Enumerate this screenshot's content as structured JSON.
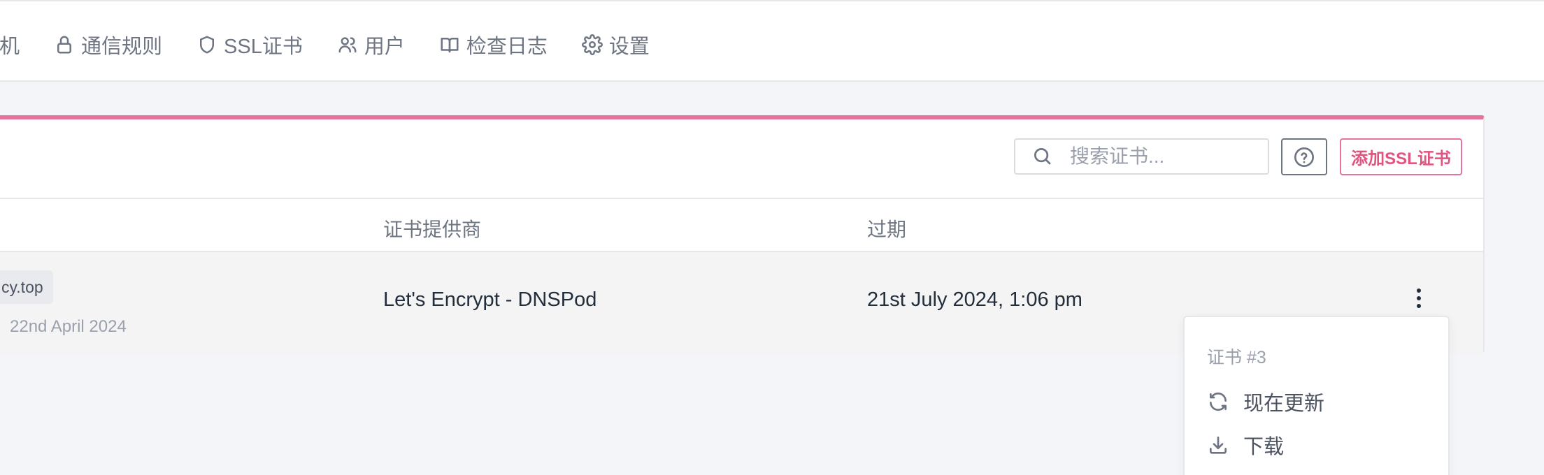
{
  "nav": {
    "items": [
      {
        "label": "主机",
        "icon": "host-icon"
      },
      {
        "label": "通信规则",
        "icon": "lock-icon"
      },
      {
        "label": "SSL证书",
        "icon": "shield-icon"
      },
      {
        "label": "用户",
        "icon": "users-icon"
      },
      {
        "label": "检查日志",
        "icon": "book-icon"
      },
      {
        "label": "设置",
        "icon": "gear-icon"
      }
    ]
  },
  "toolbar": {
    "search_placeholder": "搜索证书...",
    "help_icon": "help-circle-icon",
    "add_label": "添加SSL证书"
  },
  "table": {
    "columns": [
      "证书提供商",
      "过期"
    ],
    "rows": [
      {
        "domain": "cy.top",
        "created": "22nd April 2024",
        "provider": "Let's Encrypt - DNSPod",
        "expiry": "21st July 2024, 1:06 pm"
      }
    ]
  },
  "menu": {
    "header": "证书 #3",
    "items": [
      {
        "label": "现在更新",
        "icon": "refresh-icon"
      },
      {
        "label": "下载",
        "icon": "download-icon"
      }
    ]
  },
  "colors": {
    "accent": "#e5739c",
    "accent_text": "#e0557f",
    "background": "#f4f5f9"
  }
}
